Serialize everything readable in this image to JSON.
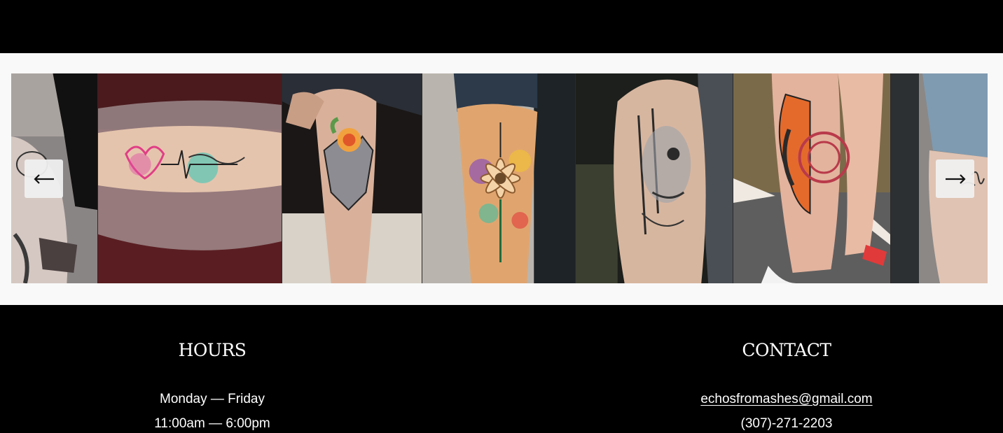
{
  "gallery": {
    "slides": [
      {
        "name": "slide-knee-tattoo",
        "icon": "photo-icon"
      },
      {
        "name": "slide-heartbeat-strength-tattoo",
        "icon": "photo-icon"
      },
      {
        "name": "slide-wolf-rose-tattoo",
        "icon": "photo-icon"
      },
      {
        "name": "slide-watercolor-daisy-tattoo",
        "icon": "photo-icon"
      },
      {
        "name": "slide-skull-face-tattoo",
        "icon": "photo-icon"
      },
      {
        "name": "slide-moth-mandala-tattoo",
        "icon": "photo-icon"
      },
      {
        "name": "slide-ankle-script-tattoo",
        "icon": "photo-icon"
      }
    ],
    "prev_icon": "arrow-left-icon",
    "next_icon": "arrow-right-icon"
  },
  "footer": {
    "hours": {
      "heading": "HOURS",
      "days": "Monday — Friday",
      "time": "11:00am — 6:00pm"
    },
    "contact": {
      "heading": "CONTACT",
      "email": "echosfromashes@gmail.com",
      "phone": "(307)-271-2203"
    }
  },
  "colors": {
    "background": "#000000",
    "gallery_background": "#f9f9f9",
    "text": "#ffffff"
  }
}
